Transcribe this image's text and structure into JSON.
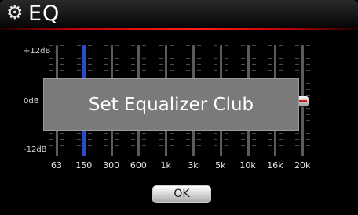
{
  "title": {
    "icon": "gear-icon",
    "text": "EQ",
    "accent_color": "#e01010"
  },
  "y_axis": {
    "max_label": "+12dB",
    "mid_label": "0dB",
    "min_label": "-12dB"
  },
  "bands": [
    {
      "label": "63",
      "level_db": 3,
      "active": false
    },
    {
      "label": "150",
      "level_db": 3,
      "active": true
    },
    {
      "label": "300",
      "level_db": 0,
      "active": false
    },
    {
      "label": "600",
      "level_db": 0,
      "active": false
    },
    {
      "label": "1k",
      "level_db": 0,
      "active": false
    },
    {
      "label": "3k",
      "level_db": 0,
      "active": false
    },
    {
      "label": "5k",
      "level_db": 0,
      "active": false
    },
    {
      "label": "10k",
      "level_db": 0,
      "active": false
    },
    {
      "label": "16k",
      "level_db": 0,
      "active": false
    },
    {
      "label": "20k",
      "level_db": 0,
      "active": false
    }
  ],
  "overlay": {
    "message": "Set Equalizer Club"
  },
  "ok_button": {
    "label": "OK"
  }
}
